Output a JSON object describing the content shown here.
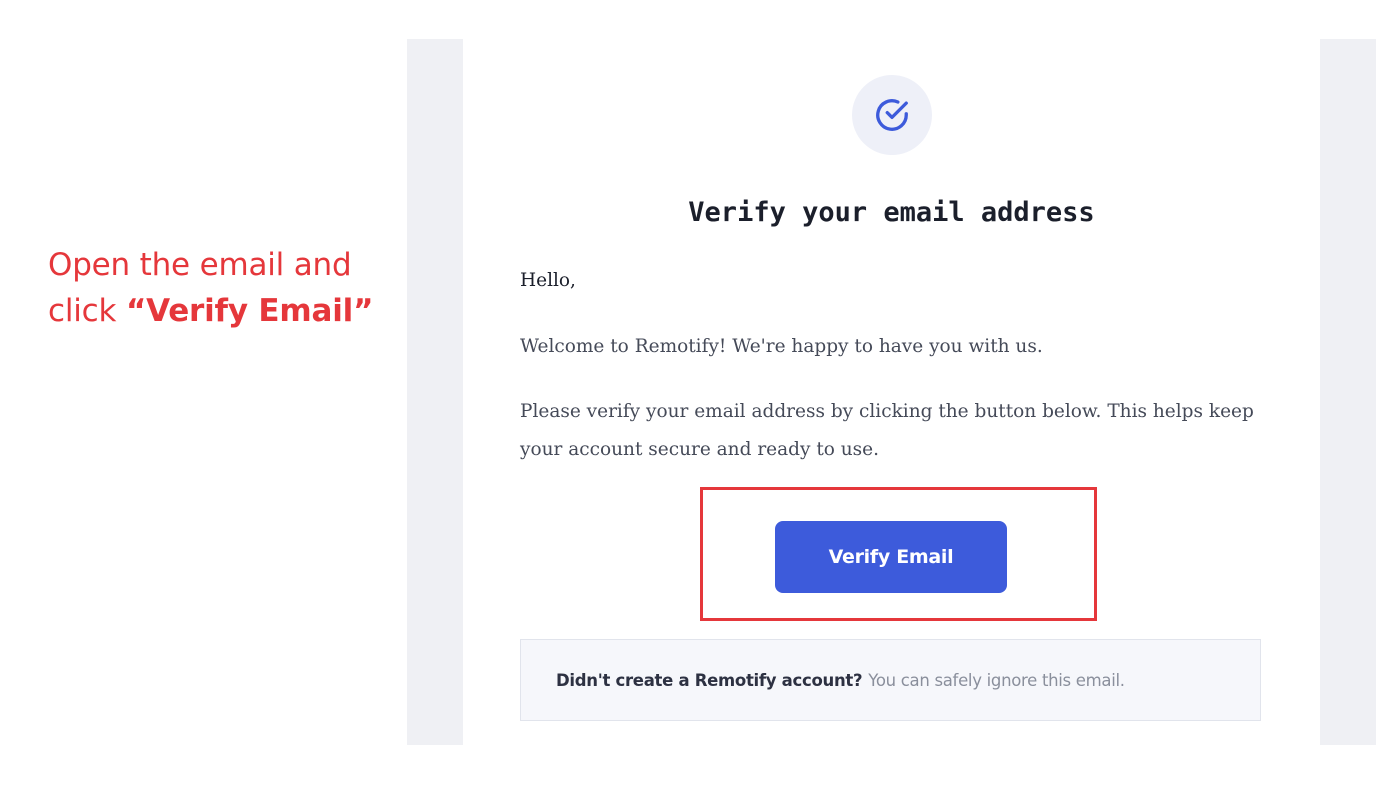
{
  "instruction": {
    "line1": "Open the email and",
    "line2_prefix": "click",
    "line2_emphasis": "“Verify Email”"
  },
  "email": {
    "icon": "check-circle-icon",
    "heading": "Verify your email address",
    "greeting": "Hello,",
    "welcome": "Welcome to Remotify! We're happy to have you with us.",
    "body": "Please verify your email address by clicking the button below. This helps keep your account secure and ready to use.",
    "button_label": "Verify Email",
    "notice_question": "Didn't create a Remotify account?",
    "notice_text": "You can safely ignore this email."
  },
  "colors": {
    "accent": "#3d5bdb",
    "annotation_red": "#e5373b",
    "heading_text": "#1b1f2b",
    "body_text": "#454a58"
  }
}
